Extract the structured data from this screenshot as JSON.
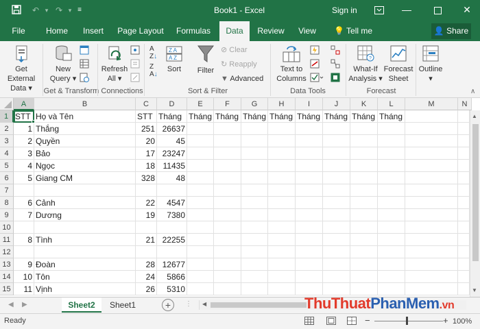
{
  "titlebar": {
    "title": "Book1  -  Excel",
    "signin": "Sign in",
    "save_icon": "save-icon",
    "undo_icon": "undo-icon",
    "redo_icon": "redo-icon",
    "customize_icon": "customize-qat-icon"
  },
  "tabs": [
    "File",
    "Home",
    "Insert",
    "Page Layout",
    "Formulas",
    "Data",
    "Review",
    "View"
  ],
  "active_tab": "Data",
  "tellme": "Tell me",
  "share": "Share",
  "ribbon": {
    "get_external": [
      "Get External",
      "Data ▾"
    ],
    "new_query": [
      "New",
      "Query ▾"
    ],
    "refresh_all": [
      "Refresh",
      "All ▾"
    ],
    "sort_az": "A→Z",
    "sort": "Sort",
    "filter": "Filter",
    "clear": "Clear",
    "reapply": "Reapply",
    "advanced": "Advanced",
    "text_to_columns": [
      "Text to",
      "Columns"
    ],
    "what_if": [
      "What-If",
      "Analysis ▾"
    ],
    "forecast_sheet": [
      "Forecast",
      "Sheet"
    ],
    "outline": [
      "Outline",
      "▾"
    ],
    "groups": {
      "get_transform": "Get & Transform",
      "connections": "Connections",
      "sort_filter": "Sort & Filter",
      "data_tools": "Data Tools",
      "forecast": "Forecast"
    }
  },
  "columns": [
    "A",
    "B",
    "C",
    "D",
    "E",
    "F",
    "G",
    "H",
    "I",
    "J",
    "K",
    "L",
    "M",
    "N"
  ],
  "rows": [
    {
      "n": "1",
      "A": "STT",
      "B": "Họ và Tên",
      "C": "STT",
      "D": "Tháng",
      "E": "Tháng",
      "F": "Tháng",
      "G": "Tháng",
      "H": "Tháng",
      "I": "Tháng",
      "J": "Tháng",
      "K": "Tháng",
      "L": "Tháng"
    },
    {
      "n": "2",
      "A": "1",
      "B": "Thắng",
      "C": "251",
      "D": "26637"
    },
    {
      "n": "3",
      "A": "2",
      "B": "Quyền",
      "C": "20",
      "D": "45"
    },
    {
      "n": "4",
      "A": "3",
      "B": "Bảo",
      "C": "17",
      "D": "23247"
    },
    {
      "n": "5",
      "A": "4",
      "B": "Ngọc",
      "C": "18",
      "D": "11435"
    },
    {
      "n": "6",
      "A": "5",
      "B": "Giang CM",
      "C": "328",
      "D": "48"
    },
    {
      "n": "7",
      "A": "",
      "B": "",
      "C": "",
      "D": ""
    },
    {
      "n": "8",
      "A": "6",
      "B": "Cảnh",
      "C": "22",
      "D": "4547"
    },
    {
      "n": "9",
      "A": "7",
      "B": "Dương",
      "C": "19",
      "D": "7380"
    },
    {
      "n": "10",
      "A": "",
      "B": "",
      "C": "",
      "D": ""
    },
    {
      "n": "11",
      "A": "8",
      "B": "Tình",
      "C": "21",
      "D": "22255"
    },
    {
      "n": "12",
      "A": "",
      "B": "",
      "C": "",
      "D": ""
    },
    {
      "n": "13",
      "A": "9",
      "B": "Đoàn",
      "C": "28",
      "D": "12677"
    },
    {
      "n": "14",
      "A": "10",
      "B": "Tôn",
      "C": "24",
      "D": "5866"
    },
    {
      "n": "15",
      "A": "11",
      "B": "Vịnh",
      "C": "26",
      "D": "5310"
    }
  ],
  "sheets": [
    "Sheet2",
    "Sheet1"
  ],
  "active_sheet": "Sheet2",
  "status": "Ready",
  "zoom": "100%",
  "watermark": "ThuThuatPhanMem.vn",
  "colors": {
    "brand": "#217346",
    "accent": "#217346"
  }
}
